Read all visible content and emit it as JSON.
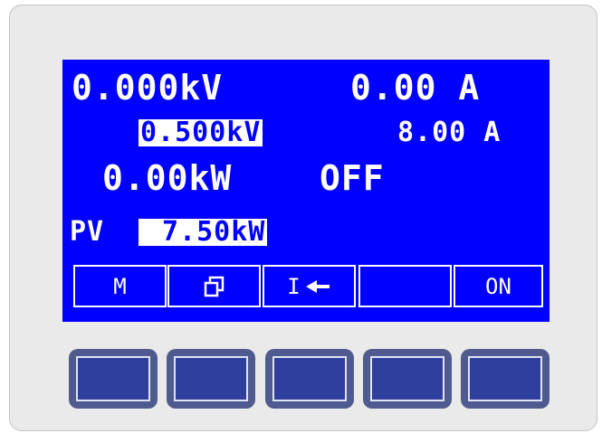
{
  "display": {
    "voltage_actual": "0.000kV",
    "current_actual": "0.00 A",
    "voltage_set": "0.500kV",
    "current_set": "8.00 A",
    "power_actual": "0.00kW",
    "output_state": "OFF",
    "power_label": "PV",
    "power_set": "7.50kW"
  },
  "softkeys": [
    {
      "label": "M",
      "icon": null
    },
    {
      "label": "",
      "icon": "copy-icon"
    },
    {
      "label": "I",
      "icon": "arrow-left-icon"
    },
    {
      "label": "",
      "icon": null
    },
    {
      "label": "ON",
      "icon": null
    }
  ],
  "colors": {
    "lcd_background": "#0000ff",
    "lcd_text": "#ffffff",
    "device_panel": "#eaeaea",
    "hardware_key": "#2f3f9e"
  }
}
